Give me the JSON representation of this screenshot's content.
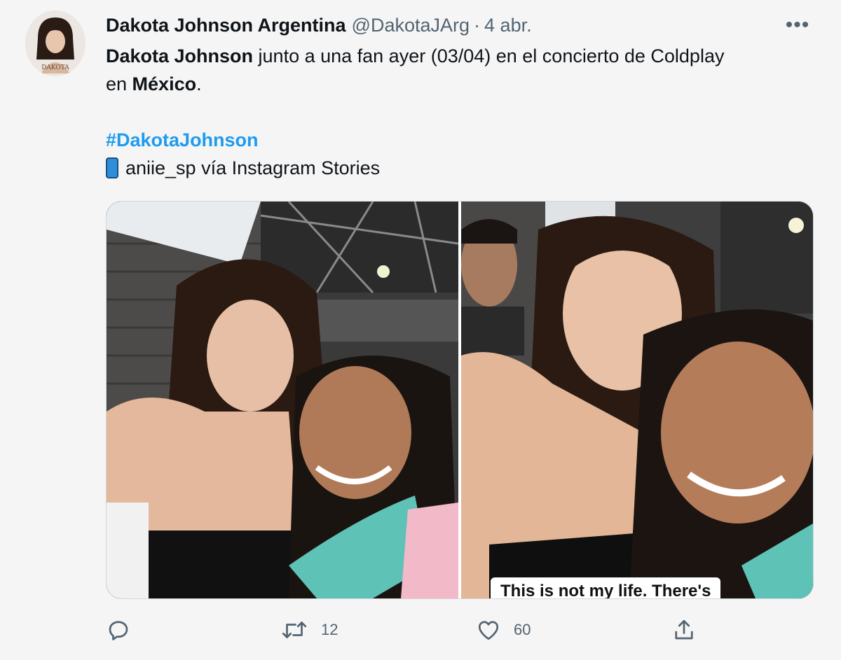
{
  "tweet": {
    "display_name": "Dakota Johnson Argentina",
    "handle": "@DakotaJArg",
    "separator": "·",
    "time": "4 abr.",
    "more_label": "•••",
    "avatar_text": "DAKOTA",
    "text": {
      "mention_name": "Dakota Johnson",
      "line1_rest": " junto a una fan ayer (03/04) en el concierto de Coldplay",
      "line2_prefix": "en ",
      "place": "México",
      "line2_suffix": ".",
      "hashtag": "#DakotaJohnson",
      "credit": "aniie_sp vía Instagram Stories"
    },
    "media": {
      "story_caption": "This is not my life. There's"
    },
    "actions": {
      "reply_count": "",
      "retweet_count": "12",
      "like_count": "60"
    }
  },
  "colors": {
    "background": "#f5f5f5",
    "text": "#0f1419",
    "secondary": "#536471",
    "link": "#1d9bf0"
  }
}
